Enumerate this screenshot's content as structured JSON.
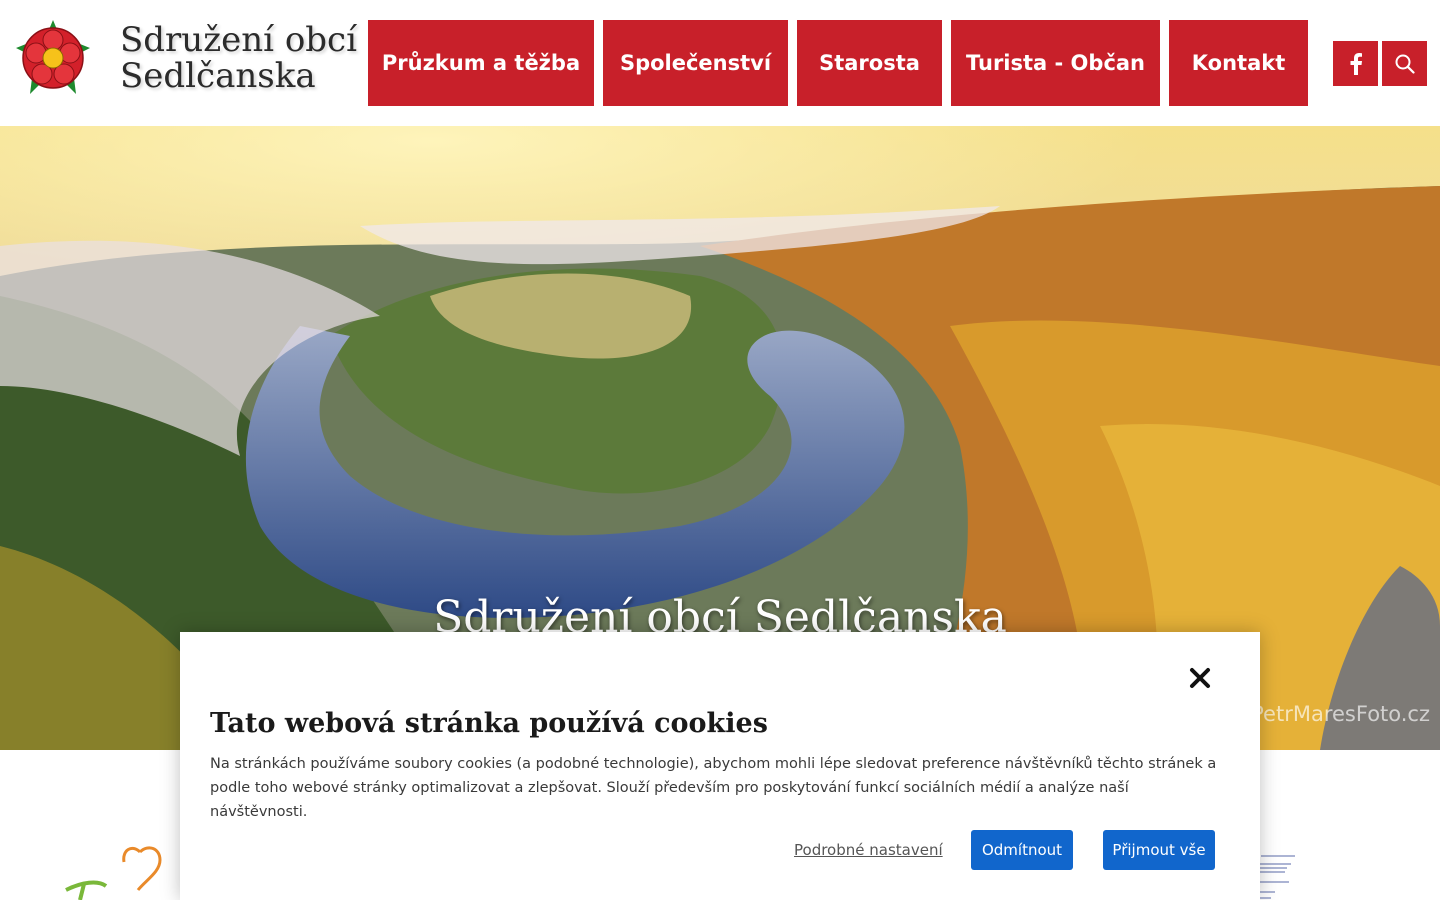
{
  "header": {
    "brand_line1": "Sdružení obcí",
    "brand_line2": "Sedlčanska",
    "nav": [
      {
        "label": "Průzkum a těžba"
      },
      {
        "label": "Společenství"
      },
      {
        "label": "Starosta"
      },
      {
        "label": "Turista - Občan"
      },
      {
        "label": "Kontakt"
      }
    ],
    "icons": {
      "facebook": "facebook-icon",
      "search": "search-icon"
    }
  },
  "hero": {
    "title": "Sdružení obcí Sedlčanska",
    "watermark": "PetrMaresFoto.cz"
  },
  "cookie": {
    "title": "Tato webová stránka používá cookies",
    "text": "Na stránkách používáme soubory cookies (a podobné technologie), abychom mohli lépe sledovat preference návštěvníků těchto stránek a podle toho webové stránky optimalizovat a zlepšovat. Slouží především pro poskytování funkcí sociálních médií a analýze naší návštěvnosti.",
    "settings_label": "Podrobné nastavení",
    "reject_label": "Odmítnout",
    "accept_label": "Přijmout vše"
  },
  "colors": {
    "brand_red": "#c8202a",
    "button_blue": "#1166cc"
  }
}
